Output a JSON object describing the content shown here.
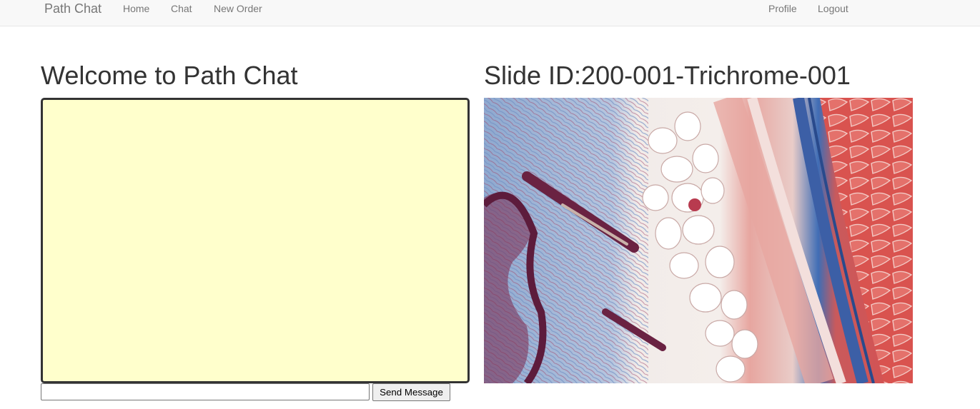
{
  "nav": {
    "brand": "Path Chat",
    "links": [
      "Home",
      "Chat",
      "New Order"
    ],
    "right_links": [
      "Profile",
      "Logout"
    ]
  },
  "chat": {
    "heading": "Welcome to Path Chat",
    "input_value": "",
    "send_label": "Send Message"
  },
  "slide": {
    "heading": "Slide ID:200-001-Trichrome-001"
  },
  "colors": {
    "chat_background": "#ffffcc",
    "navbar_background": "#f8f8f8"
  }
}
